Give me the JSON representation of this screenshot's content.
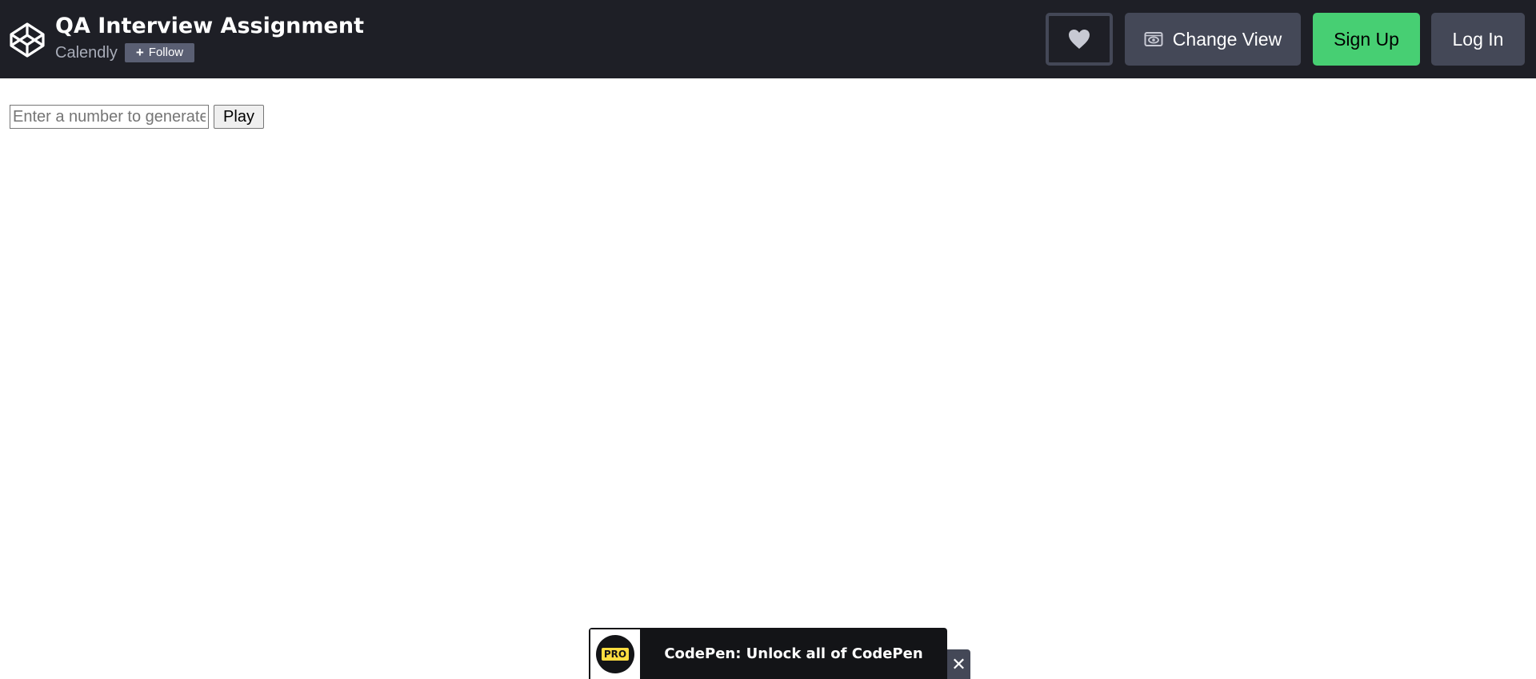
{
  "header": {
    "logo_icon": "codepen-logo-icon",
    "title": "QA Interview Assignment",
    "owner": "Calendly",
    "follow_label": "Follow",
    "heart_icon": "heart-icon",
    "change_view_label": "Change View",
    "change_view_icon": "eye-icon",
    "signup_label": "Sign Up",
    "login_label": "Log In"
  },
  "result": {
    "input_placeholder": "Enter a number to generate",
    "input_value": "",
    "play_label": "Play"
  },
  "pro_banner": {
    "badge_text": "PRO",
    "text": "CodePen: Unlock all of CodePen",
    "close_icon": "close-icon"
  },
  "colors": {
    "header_bg": "#1e1f26",
    "button_gray": "#444857",
    "signup_green": "#47cf73",
    "pro_yellow": "#ffdd40"
  }
}
